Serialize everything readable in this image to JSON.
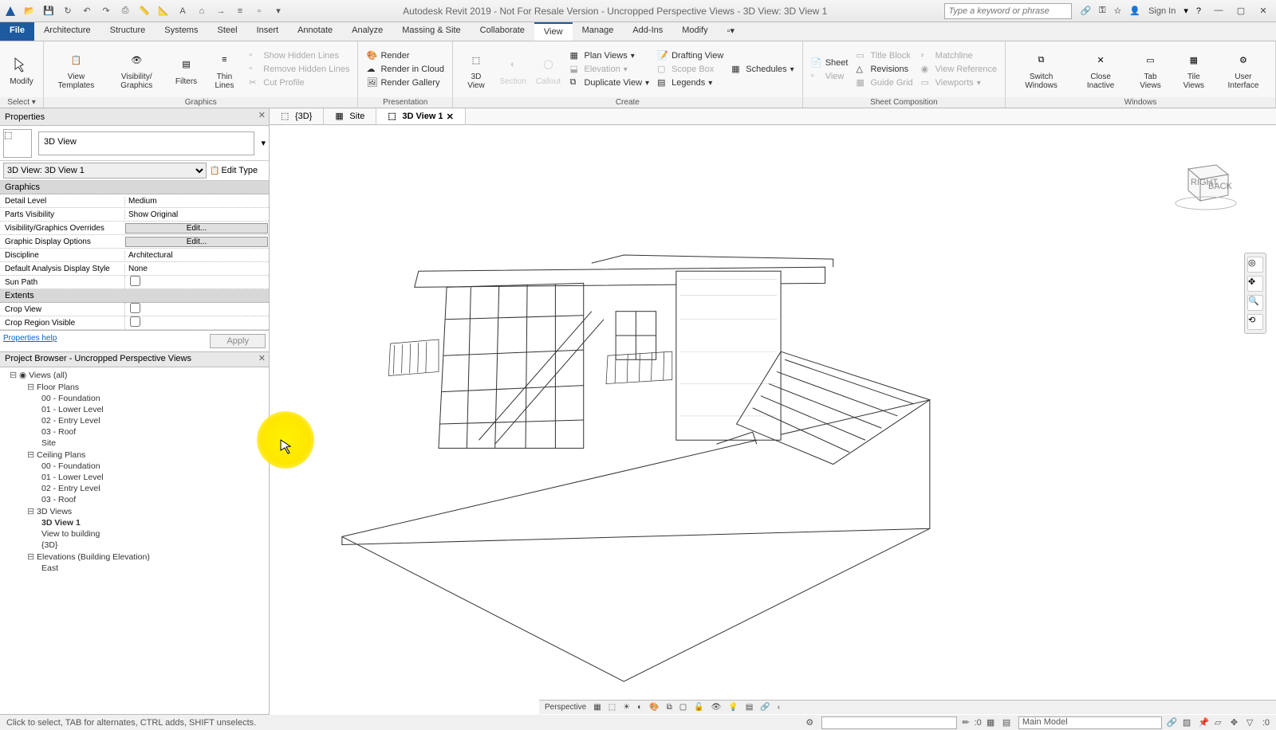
{
  "titlebar": {
    "title": "Autodesk Revit 2019 - Not For Resale Version - Uncropped Perspective Views - 3D View: 3D View 1",
    "search_placeholder": "Type a keyword or phrase",
    "signin": "Sign In"
  },
  "ribbon_tabs": {
    "file": "File",
    "tabs": [
      "Architecture",
      "Structure",
      "Systems",
      "Steel",
      "Insert",
      "Annotate",
      "Analyze",
      "Massing & Site",
      "Collaborate",
      "View",
      "Manage",
      "Add-Ins",
      "Modify"
    ],
    "active": "View"
  },
  "ribbon": {
    "select": {
      "modify": "Modify",
      "panel_label": "Select ▾"
    },
    "graphics": {
      "view_templates": "View\nTemplates",
      "visibility": "Visibility/\nGraphics",
      "filters": "Filters",
      "thin_lines": "Thin\nLines",
      "show_hidden": "Show Hidden Lines",
      "remove_hidden": "Remove Hidden Lines",
      "cut_profile": "Cut Profile",
      "panel_label": "Graphics"
    },
    "presentation": {
      "render": "Render",
      "render_cloud": "Render in Cloud",
      "render_gallery": "Render Gallery",
      "panel_label": "Presentation"
    },
    "create": {
      "view_3d": "3D\nView",
      "section": "Section",
      "callout": "Callout",
      "plan_views": "Plan Views",
      "elevation": "Elevation",
      "duplicate": "Duplicate View",
      "legends": "Legends",
      "drafting_view": "Drafting View",
      "schedules": "Schedules",
      "scope_box": "Scope Box",
      "panel_label": "Create"
    },
    "sheet_comp": {
      "sheet": "Sheet",
      "view": "View",
      "title_block": "Title Block",
      "revisions": "Revisions",
      "guide_grid": "Guide Grid",
      "matchline": "Matchline",
      "view_reference": "View Reference",
      "viewports": "Viewports",
      "panel_label": "Sheet Composition"
    },
    "windows": {
      "switch_windows": "Switch\nWindows",
      "close_inactive": "Close\nInactive",
      "tab_views": "Tab\nViews",
      "tile_views": "Tile\nViews",
      "user_interface": "User\nInterface",
      "panel_label": "Windows"
    }
  },
  "view_tabs": {
    "tabs": [
      {
        "icon": "3d",
        "label": "{3D}"
      },
      {
        "icon": "plan",
        "label": "Site"
      },
      {
        "icon": "3d",
        "label": "3D View 1",
        "active": true
      }
    ]
  },
  "properties": {
    "header": "Properties",
    "type_name": "3D View",
    "instance_selector": "3D View: 3D View 1",
    "edit_type": "Edit Type",
    "groups": [
      {
        "name": "Graphics",
        "rows": [
          {
            "name": "Detail Level",
            "value": "Medium",
            "type": "text"
          },
          {
            "name": "Parts Visibility",
            "value": "Show Original",
            "type": "text"
          },
          {
            "name": "Visibility/Graphics Overrides",
            "value": "Edit...",
            "type": "btn"
          },
          {
            "name": "Graphic Display Options",
            "value": "Edit...",
            "type": "btn"
          },
          {
            "name": "Discipline",
            "value": "Architectural",
            "type": "text"
          },
          {
            "name": "Default Analysis Display Style",
            "value": "None",
            "type": "text"
          },
          {
            "name": "Sun Path",
            "value": "",
            "type": "check"
          }
        ]
      },
      {
        "name": "Extents",
        "rows": [
          {
            "name": "Crop View",
            "value": "",
            "type": "check"
          },
          {
            "name": "Crop Region Visible",
            "value": "",
            "type": "check"
          }
        ]
      }
    ],
    "help_link": "Properties help",
    "apply": "Apply"
  },
  "browser": {
    "header": "Project Browser - Uncropped Perspective Views",
    "root": "Views (all)",
    "groups": [
      {
        "name": "Floor Plans",
        "items": [
          "00 - Foundation",
          "01 - Lower Level",
          "02 - Entry Level",
          "03 - Roof",
          "Site"
        ]
      },
      {
        "name": "Ceiling Plans",
        "items": [
          "00 - Foundation",
          "01 - Lower Level",
          "02 - Entry Level",
          "03 - Roof"
        ]
      },
      {
        "name": "3D Views",
        "items": [
          "3D View 1",
          "View to building",
          "{3D}"
        ],
        "bold_index": 0
      },
      {
        "name": "Elevations (Building Elevation)",
        "items": [
          "East"
        ]
      }
    ]
  },
  "view_bar": {
    "scale": "Perspective"
  },
  "status": {
    "hint": "Click to select, TAB for alternates, CTRL adds, SHIFT unselects.",
    "scale_input": ":0",
    "workset": "Main Model"
  },
  "nav_cube": {
    "face1": "RIGHT",
    "face2": "BACK"
  }
}
